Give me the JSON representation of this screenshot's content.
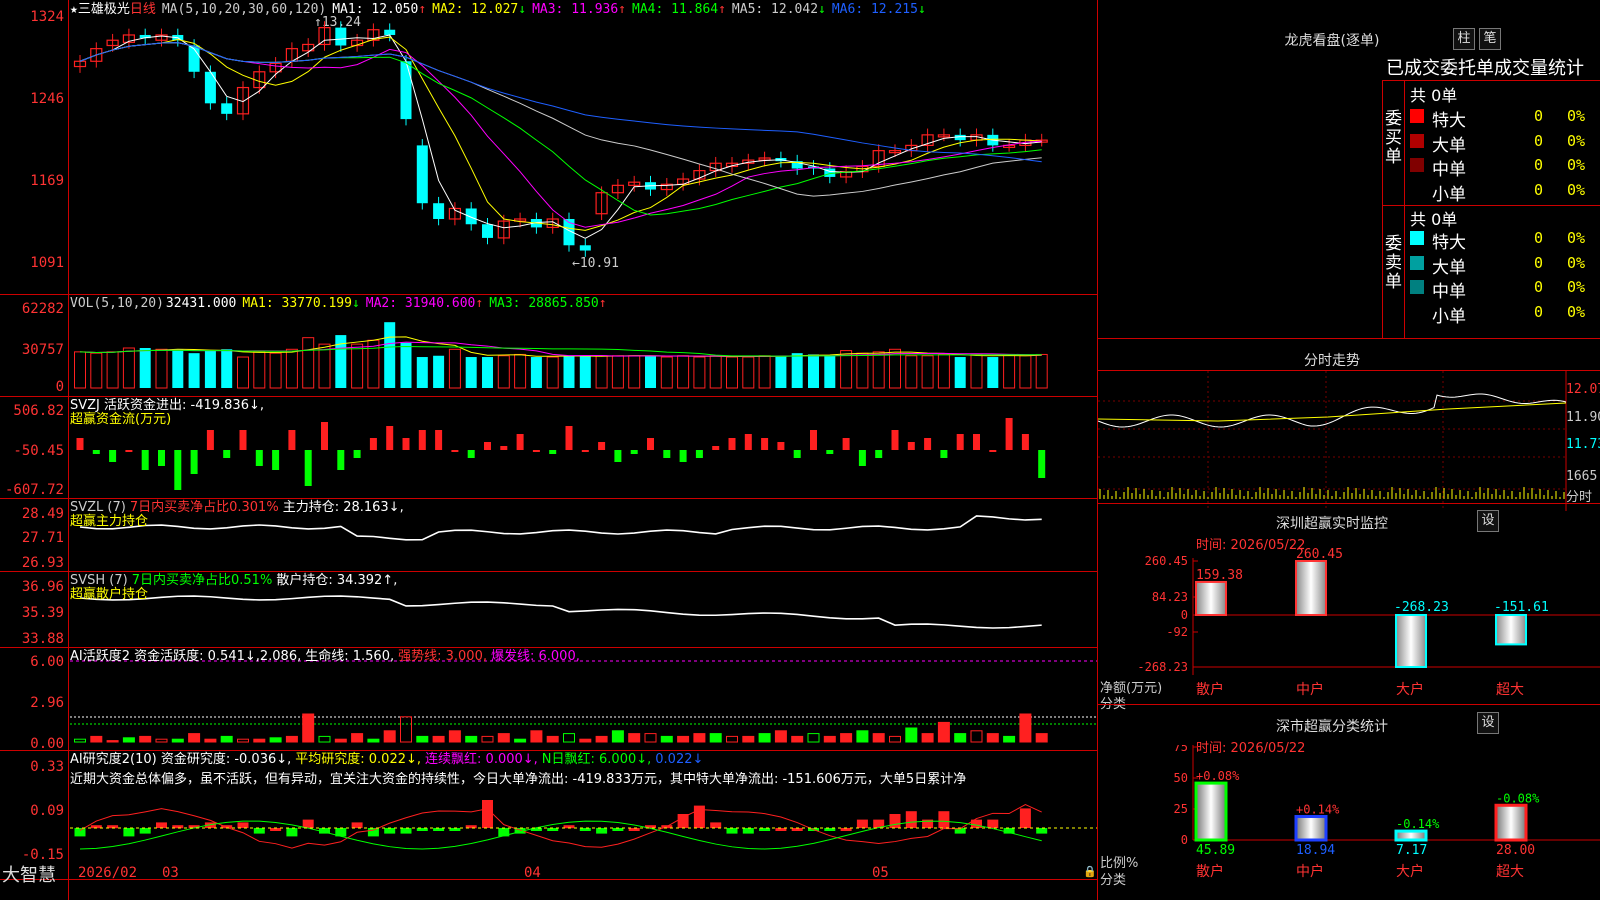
{
  "stock": {
    "name": "三雄极光",
    "period": "日线",
    "star": "★"
  },
  "k": {
    "ma_label": "MA(5,10,20,30,60,120)",
    "ma": [
      {
        "t": "MA1: 12.050",
        "a": "↑",
        "c": "#ffffff"
      },
      {
        "t": "MA2: 12.027",
        "a": "↓",
        "c": "#ffff00"
      },
      {
        "t": "MA3: 11.936",
        "a": "↑",
        "c": "#ff00ff"
      },
      {
        "t": "MA4: 11.864",
        "a": "↑",
        "c": "#00ff00"
      },
      {
        "t": "MA5: 12.042",
        "a": "↓",
        "c": "#cccccc"
      },
      {
        "t": "MA6: 12.215",
        "a": "↓",
        "c": "#1e5fff"
      }
    ],
    "yticks": [
      "1324",
      "1246",
      "1169",
      "1091"
    ],
    "high_note": "13.24",
    "low_note": "←10.91"
  },
  "vol": {
    "label": "VOL(5,10,20)",
    "val": "32431.000",
    "ma": [
      {
        "t": "MA1: 33770.199",
        "a": "↓",
        "c": "#ffff00"
      },
      {
        "t": "MA2: 31940.600",
        "a": "↑",
        "c": "#ff00ff"
      },
      {
        "t": "MA3: 28865.850",
        "a": "↑",
        "c": "#00ff00"
      }
    ],
    "yticks": [
      "62282",
      "30757",
      "0"
    ]
  },
  "svzj": {
    "line1": "SVZJ  活跃资金进出: -419.836↓,",
    "line2": "超赢资金流(万元)",
    "yticks": [
      "506.82",
      "-50.45",
      "-607.72"
    ]
  },
  "svzl": {
    "p1": "SVZL (7)",
    "p2": "7日内买卖净占比0.301%",
    "p3": "主力持仓: 28.163↓,",
    "line2": "超赢主力持仓",
    "yticks": [
      "28.49",
      "27.71",
      "26.93"
    ]
  },
  "svsh": {
    "p1": "SVSH (7)",
    "p2": "7日内买卖净占比0.51%",
    "p3": "散户持仓: 34.392↑,",
    "line2": "超赢散户持仓",
    "yticks": [
      "36.96",
      "35.39",
      "33.88"
    ]
  },
  "ai1": {
    "p1": "AI活跃度2 资金活跃度: 0.541↓,2.086,",
    "p2": "生命线: 1.560,",
    "p3": "强势线: 3.000,",
    "p4": "爆发线: 6.000,",
    "yticks": [
      "6.00",
      "2.96",
      "0.00"
    ]
  },
  "ai2": {
    "p1": "AI研究度2(10) 资金研究度: -0.036↓,",
    "p2": "平均研究度: 0.022↓,",
    "p3": "连续飘红: 0.000↓,",
    "p4": "N日飘红: 6.000↓,",
    "p5": "0.022↓",
    "text": "近期大资金总体偏多，虽不活跃，但有异动，宜关注大资金的持续性，今日大单净流出: -419.833万元，其中特大单净流出: -151.606万元，大单5日累计净",
    "yticks": [
      "0.33",
      "0.09",
      "-0.15"
    ]
  },
  "xaxis": {
    "brand": "大智慧",
    "labels": [
      "2026/02",
      "03",
      "04",
      "05"
    ]
  },
  "lhb": {
    "title": "龙虎看盘(逐单)",
    "btn1": "柱",
    "btn2": "笔",
    "tab_text": "已成交委托单成交量统计",
    "buy_title": "委买单",
    "buy_total": "共 0单",
    "sell_title": "委卖单",
    "sell_total": "共 0单",
    "rows_buy": [
      {
        "n": "特大",
        "v": "0",
        "p": "0%",
        "c": "#ff0000"
      },
      {
        "n": "大单",
        "v": "0",
        "p": "0%",
        "c": "#b00000"
      },
      {
        "n": "中单",
        "v": "0",
        "p": "0%",
        "c": "#800000"
      },
      {
        "n": "小单",
        "v": "0",
        "p": "0%",
        "c": "#000000"
      }
    ],
    "rows_sell": [
      {
        "n": "特大",
        "v": "0",
        "p": "0%",
        "c": "#00ffff"
      },
      {
        "n": "大单",
        "v": "0",
        "p": "0%",
        "c": "#00a0a0"
      },
      {
        "n": "中单",
        "v": "0",
        "p": "0%",
        "c": "#008080"
      },
      {
        "n": "小单",
        "v": "0",
        "p": "0%",
        "c": "#000000"
      }
    ]
  },
  "fs": {
    "title": "分时走势",
    "prices": [
      "12.07",
      "11.90",
      "11.73"
    ],
    "vol": "1665",
    "vol_unit": "分时"
  },
  "sz1": {
    "title": "深圳超赢实时监控",
    "btn": "设",
    "time": "时间: 2026/05/22",
    "ylab1": "净额(万元)",
    "ylab2": "分类",
    "yticks": [
      "260.45",
      "84.23",
      "0",
      "-92",
      "-268.23"
    ],
    "chart_data": {
      "type": "bar",
      "categories": [
        "散户",
        "中户",
        "大户",
        "超大"
      ],
      "values": [
        159.38,
        260.45,
        -268.23,
        -151.61
      ],
      "ylim": [
        -268.23,
        260.45
      ]
    }
  },
  "sz2": {
    "title": "深市超赢分类统计",
    "btn": "设",
    "time": "时间: 2026/05/22",
    "ylab1": "比例%",
    "ylab2": "分类",
    "yticks": [
      "75",
      "50",
      "25",
      "0"
    ],
    "chart_data": {
      "type": "bar",
      "categories": [
        "散户",
        "中户",
        "大户",
        "超大"
      ],
      "values": [
        45.89,
        18.94,
        7.17,
        28.0
      ],
      "changes": [
        "+0.08%",
        "+0.14%",
        "-0.14%",
        "-0.08%"
      ],
      "ylim": [
        0,
        75
      ]
    }
  },
  "colors": {
    "up": "#ff2020",
    "down": "#00ffff",
    "grid": "#c00000",
    "label": "#ff3333"
  }
}
